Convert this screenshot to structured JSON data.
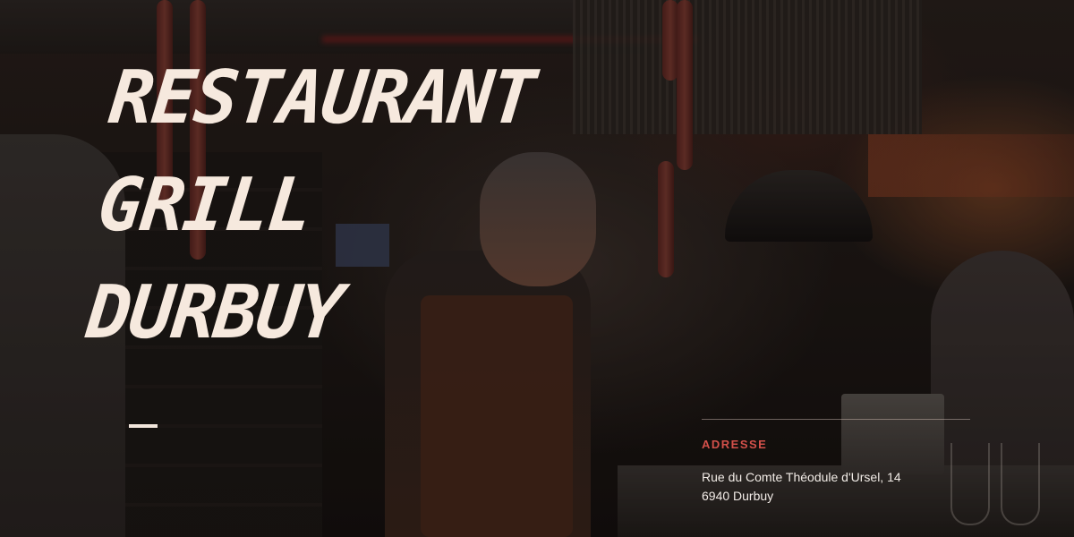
{
  "hero": {
    "title_lines": [
      "RESTAURANT",
      "GRILL",
      "DURBUY"
    ]
  },
  "address": {
    "label": "ADRESSE",
    "line1": "Rue du Comte Théodule d'Ursel, 14",
    "line2": "6940 Durbuy"
  },
  "colors": {
    "accent": "#d2504a",
    "title_text": "#f6e9de"
  }
}
